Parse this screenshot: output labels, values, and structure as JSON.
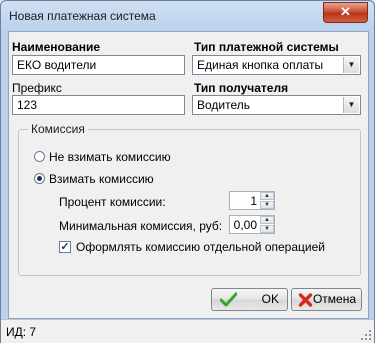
{
  "window": {
    "title": "Новая платежная система",
    "close_label": "✕"
  },
  "form": {
    "name_label": "Наименование",
    "name_value": "ЕКО водители",
    "system_type_label": "Тип платежной системы",
    "system_type_value": "Единая кнопка оплаты",
    "prefix_label": "Префикс",
    "prefix_value": "123",
    "recipient_type_label": "Тип получателя",
    "recipient_type_value": "Водитель"
  },
  "commission": {
    "group_label": "Комиссия",
    "no_commission_label": "Не взимать комиссию",
    "charge_commission_label": "Взимать комиссию",
    "selected": "charge",
    "percent_label": "Процент комиссии:",
    "percent_value": "1",
    "min_label": "Минимальная комиссия, руб:",
    "min_value": "0,00",
    "separate_op_label": "Оформлять комиссию отдельной операцией",
    "separate_op_checked": true
  },
  "buttons": {
    "ok_label": "OK",
    "cancel_label": "Отмена"
  },
  "status": {
    "text": "ИД: 7"
  },
  "icons": {
    "ok": "check-icon",
    "cancel": "cross-icon",
    "ok_color": "#3aa52a",
    "cancel_color": "#d42b1e"
  }
}
